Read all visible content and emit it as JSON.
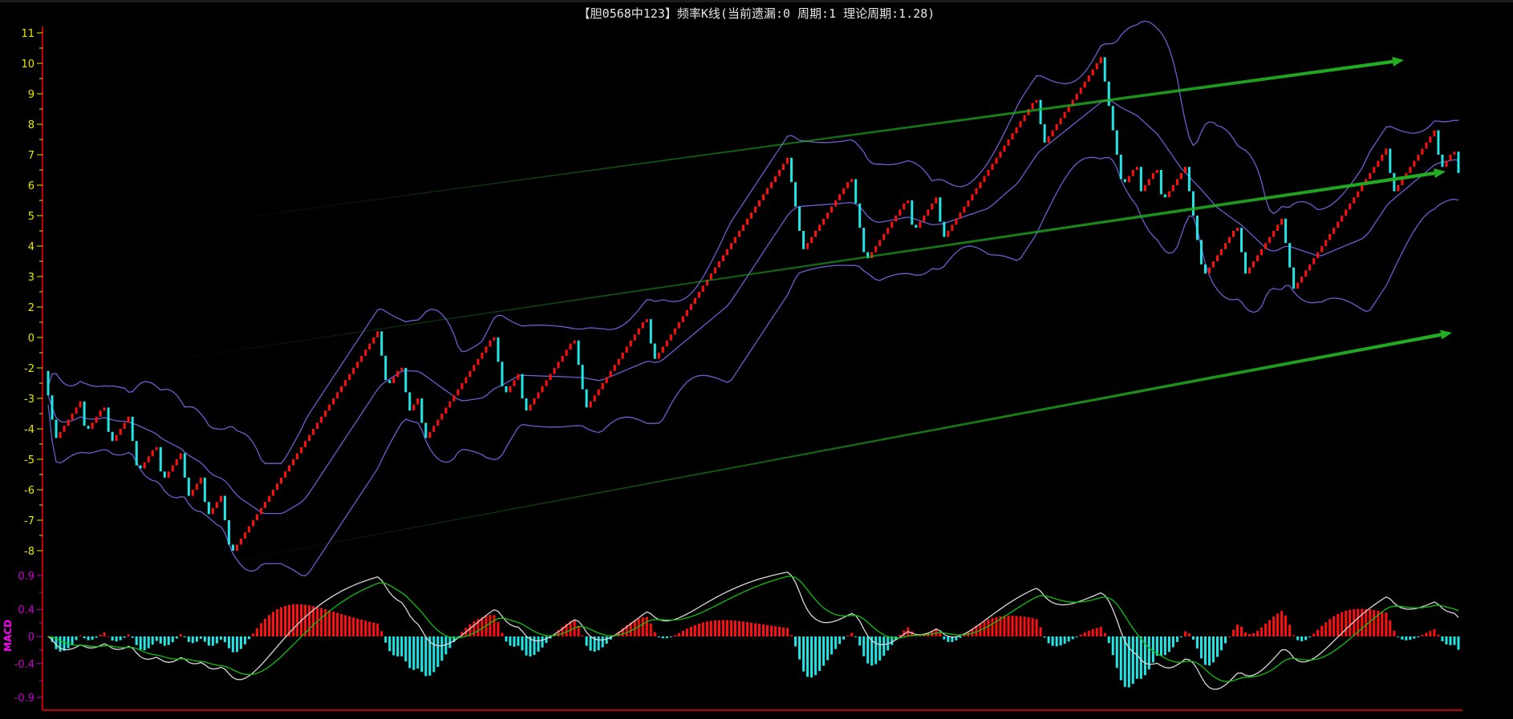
{
  "title": "【胆0568中123】频率K线(当前遗漏:0 周期:1 理论周期:1.28)",
  "colors": {
    "up": "#ff1010",
    "down": "#22e6e6",
    "band": "#6a5fd0",
    "axis": "#c00000",
    "price_label": "#e8e800",
    "macd_label": "#cc00cc",
    "dif": "#d8d8d8",
    "dea": "#10c010",
    "trend": "#22b022"
  },
  "chart_data": [
    {
      "type": "candlestick",
      "title": "频率K线",
      "ylim": [
        -6.3,
        11.2
      ],
      "yticks": [
        {
          "value": 11,
          "label": "11"
        },
        {
          "value": 10,
          "label": "10"
        },
        {
          "value": 9,
          "label": "9"
        },
        {
          "value": 8,
          "label": "8"
        },
        {
          "value": 7,
          "label": "7"
        },
        {
          "value": 6,
          "label": "6"
        },
        {
          "value": 5,
          "label": "5"
        },
        {
          "value": 4,
          "label": "4"
        },
        {
          "value": 3,
          "label": "3"
        },
        {
          "value": 2,
          "label": "2"
        },
        {
          "value": 1,
          "label": "0"
        },
        {
          "value": 0,
          "label": "-2"
        },
        {
          "value": -1,
          "label": "-3"
        },
        {
          "value": -2,
          "label": "-4"
        },
        {
          "value": -3,
          "label": "-5"
        },
        {
          "value": -4,
          "label": "-6"
        },
        {
          "value": -5,
          "label": "-7"
        },
        {
          "value": -6,
          "label": "-8"
        }
      ],
      "brick_up": 0.2,
      "bar_down_max": 0.8,
      "swing_points": [
        -0.1,
        -2.3,
        -1.1,
        -2.0,
        -1.3,
        -2.4,
        -1.6,
        -3.3,
        -2.6,
        -3.6,
        -2.8,
        -4.2,
        -3.6,
        -4.8,
        -4.2,
        -6.0,
        1.2,
        -0.5,
        0.0,
        -1.4,
        -1.0,
        -2.3,
        1.0,
        -0.8,
        -0.2,
        -1.4,
        0.9,
        -1.3,
        1.6,
        0.3,
        6.9,
        3.9,
        6.2,
        3.6,
        5.5,
        4.6,
        5.6,
        4.3,
        8.8,
        7.4,
        10.2,
        6.1,
        6.6,
        5.8,
        6.5,
        5.6,
        6.6,
        3.1,
        4.6,
        3.1,
        4.9,
        2.6,
        7.2,
        5.8,
        7.8,
        6.6,
        7.1,
        6.4
      ],
      "overlays": [
        "Bollinger(20,2) upper",
        "Bollinger middle",
        "Bollinger lower",
        "3 trend arrows"
      ]
    },
    {
      "type": "macd",
      "title": "MACD",
      "ylim": [
        -1.1,
        1.1
      ],
      "yticks": [
        {
          "value": 0.9,
          "label": "0.9"
        },
        {
          "value": 0.4,
          "label": "0.4"
        },
        {
          "value": 0,
          "label": "0"
        },
        {
          "value": -0.4,
          "label": "-0.4"
        },
        {
          "value": -0.9,
          "label": "-0.9"
        }
      ],
      "params": {
        "fast": 12,
        "slow": 26,
        "signal": 9
      }
    }
  ]
}
